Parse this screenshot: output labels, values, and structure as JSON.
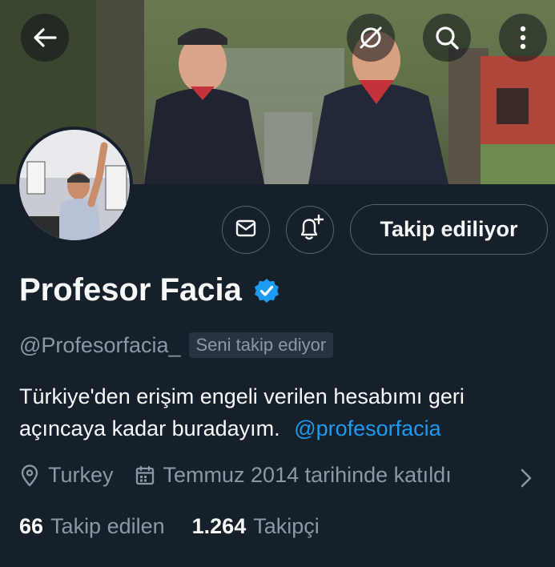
{
  "header": {
    "icons": [
      "back-arrow-icon",
      "grok-icon",
      "search-icon",
      "more-icon"
    ]
  },
  "profile": {
    "name": "Profesor Facia",
    "handle": "@Profesorfacia_",
    "follows_you": "Seni takip ediyor",
    "bio_text": "Türkiye'den erişim engeli verilen hesabımı geri açıncaya kadar buradayım.",
    "bio_mention": "@profesorfacia",
    "location": "Turkey",
    "joined": "Temmuz 2014 tarihinde katıldı",
    "following_count": "66",
    "following_label": "Takip edilen",
    "followers_count": "1.264",
    "followers_label": "Takipçi"
  },
  "actions": {
    "follow_label": "Takip ediliyor",
    "icons": [
      "mail-icon",
      "bell-plus-icon"
    ]
  },
  "colors": {
    "background": "#15202b",
    "accent": "#1d9bf0",
    "secondary_text": "#8b98a5",
    "border": "#536471"
  }
}
